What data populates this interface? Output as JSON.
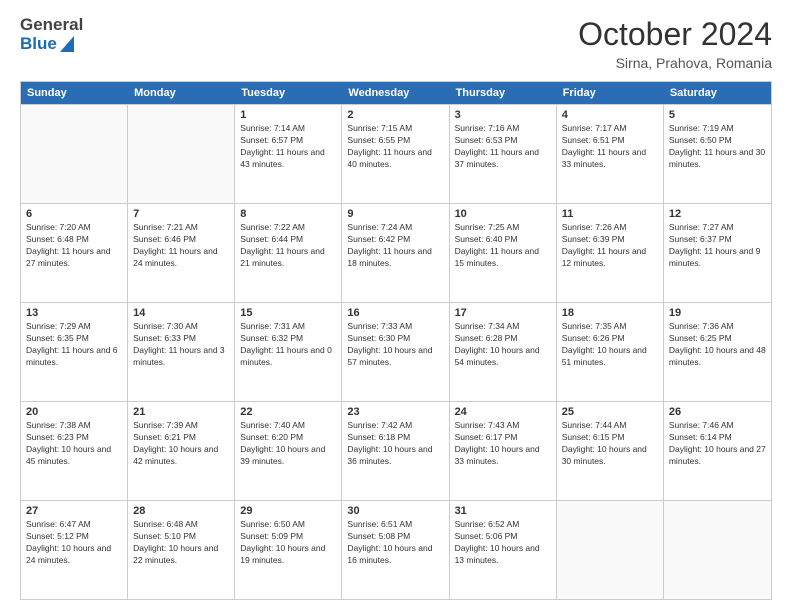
{
  "logo": {
    "general": "General",
    "blue": "Blue"
  },
  "title": "October 2024",
  "location": "Sirna, Prahova, Romania",
  "days": [
    "Sunday",
    "Monday",
    "Tuesday",
    "Wednesday",
    "Thursday",
    "Friday",
    "Saturday"
  ],
  "weeks": [
    [
      {
        "day": "",
        "sunrise": "",
        "sunset": "",
        "daylight": ""
      },
      {
        "day": "",
        "sunrise": "",
        "sunset": "",
        "daylight": ""
      },
      {
        "day": "1",
        "sunrise": "Sunrise: 7:14 AM",
        "sunset": "Sunset: 6:57 PM",
        "daylight": "Daylight: 11 hours and 43 minutes."
      },
      {
        "day": "2",
        "sunrise": "Sunrise: 7:15 AM",
        "sunset": "Sunset: 6:55 PM",
        "daylight": "Daylight: 11 hours and 40 minutes."
      },
      {
        "day": "3",
        "sunrise": "Sunrise: 7:16 AM",
        "sunset": "Sunset: 6:53 PM",
        "daylight": "Daylight: 11 hours and 37 minutes."
      },
      {
        "day": "4",
        "sunrise": "Sunrise: 7:17 AM",
        "sunset": "Sunset: 6:51 PM",
        "daylight": "Daylight: 11 hours and 33 minutes."
      },
      {
        "day": "5",
        "sunrise": "Sunrise: 7:19 AM",
        "sunset": "Sunset: 6:50 PM",
        "daylight": "Daylight: 11 hours and 30 minutes."
      }
    ],
    [
      {
        "day": "6",
        "sunrise": "Sunrise: 7:20 AM",
        "sunset": "Sunset: 6:48 PM",
        "daylight": "Daylight: 11 hours and 27 minutes."
      },
      {
        "day": "7",
        "sunrise": "Sunrise: 7:21 AM",
        "sunset": "Sunset: 6:46 PM",
        "daylight": "Daylight: 11 hours and 24 minutes."
      },
      {
        "day": "8",
        "sunrise": "Sunrise: 7:22 AM",
        "sunset": "Sunset: 6:44 PM",
        "daylight": "Daylight: 11 hours and 21 minutes."
      },
      {
        "day": "9",
        "sunrise": "Sunrise: 7:24 AM",
        "sunset": "Sunset: 6:42 PM",
        "daylight": "Daylight: 11 hours and 18 minutes."
      },
      {
        "day": "10",
        "sunrise": "Sunrise: 7:25 AM",
        "sunset": "Sunset: 6:40 PM",
        "daylight": "Daylight: 11 hours and 15 minutes."
      },
      {
        "day": "11",
        "sunrise": "Sunrise: 7:26 AM",
        "sunset": "Sunset: 6:39 PM",
        "daylight": "Daylight: 11 hours and 12 minutes."
      },
      {
        "day": "12",
        "sunrise": "Sunrise: 7:27 AM",
        "sunset": "Sunset: 6:37 PM",
        "daylight": "Daylight: 11 hours and 9 minutes."
      }
    ],
    [
      {
        "day": "13",
        "sunrise": "Sunrise: 7:29 AM",
        "sunset": "Sunset: 6:35 PM",
        "daylight": "Daylight: 11 hours and 6 minutes."
      },
      {
        "day": "14",
        "sunrise": "Sunrise: 7:30 AM",
        "sunset": "Sunset: 6:33 PM",
        "daylight": "Daylight: 11 hours and 3 minutes."
      },
      {
        "day": "15",
        "sunrise": "Sunrise: 7:31 AM",
        "sunset": "Sunset: 6:32 PM",
        "daylight": "Daylight: 11 hours and 0 minutes."
      },
      {
        "day": "16",
        "sunrise": "Sunrise: 7:33 AM",
        "sunset": "Sunset: 6:30 PM",
        "daylight": "Daylight: 10 hours and 57 minutes."
      },
      {
        "day": "17",
        "sunrise": "Sunrise: 7:34 AM",
        "sunset": "Sunset: 6:28 PM",
        "daylight": "Daylight: 10 hours and 54 minutes."
      },
      {
        "day": "18",
        "sunrise": "Sunrise: 7:35 AM",
        "sunset": "Sunset: 6:26 PM",
        "daylight": "Daylight: 10 hours and 51 minutes."
      },
      {
        "day": "19",
        "sunrise": "Sunrise: 7:36 AM",
        "sunset": "Sunset: 6:25 PM",
        "daylight": "Daylight: 10 hours and 48 minutes."
      }
    ],
    [
      {
        "day": "20",
        "sunrise": "Sunrise: 7:38 AM",
        "sunset": "Sunset: 6:23 PM",
        "daylight": "Daylight: 10 hours and 45 minutes."
      },
      {
        "day": "21",
        "sunrise": "Sunrise: 7:39 AM",
        "sunset": "Sunset: 6:21 PM",
        "daylight": "Daylight: 10 hours and 42 minutes."
      },
      {
        "day": "22",
        "sunrise": "Sunrise: 7:40 AM",
        "sunset": "Sunset: 6:20 PM",
        "daylight": "Daylight: 10 hours and 39 minutes."
      },
      {
        "day": "23",
        "sunrise": "Sunrise: 7:42 AM",
        "sunset": "Sunset: 6:18 PM",
        "daylight": "Daylight: 10 hours and 36 minutes."
      },
      {
        "day": "24",
        "sunrise": "Sunrise: 7:43 AM",
        "sunset": "Sunset: 6:17 PM",
        "daylight": "Daylight: 10 hours and 33 minutes."
      },
      {
        "day": "25",
        "sunrise": "Sunrise: 7:44 AM",
        "sunset": "Sunset: 6:15 PM",
        "daylight": "Daylight: 10 hours and 30 minutes."
      },
      {
        "day": "26",
        "sunrise": "Sunrise: 7:46 AM",
        "sunset": "Sunset: 6:14 PM",
        "daylight": "Daylight: 10 hours and 27 minutes."
      }
    ],
    [
      {
        "day": "27",
        "sunrise": "Sunrise: 6:47 AM",
        "sunset": "Sunset: 5:12 PM",
        "daylight": "Daylight: 10 hours and 24 minutes."
      },
      {
        "day": "28",
        "sunrise": "Sunrise: 6:48 AM",
        "sunset": "Sunset: 5:10 PM",
        "daylight": "Daylight: 10 hours and 22 minutes."
      },
      {
        "day": "29",
        "sunrise": "Sunrise: 6:50 AM",
        "sunset": "Sunset: 5:09 PM",
        "daylight": "Daylight: 10 hours and 19 minutes."
      },
      {
        "day": "30",
        "sunrise": "Sunrise: 6:51 AM",
        "sunset": "Sunset: 5:08 PM",
        "daylight": "Daylight: 10 hours and 16 minutes."
      },
      {
        "day": "31",
        "sunrise": "Sunrise: 6:52 AM",
        "sunset": "Sunset: 5:06 PM",
        "daylight": "Daylight: 10 hours and 13 minutes."
      },
      {
        "day": "",
        "sunrise": "",
        "sunset": "",
        "daylight": ""
      },
      {
        "day": "",
        "sunrise": "",
        "sunset": "",
        "daylight": ""
      }
    ]
  ]
}
